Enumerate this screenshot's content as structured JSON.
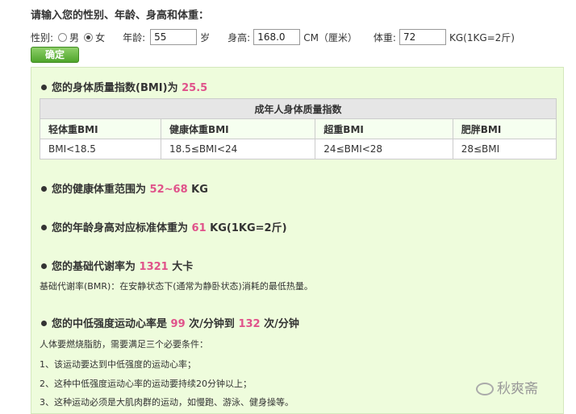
{
  "form": {
    "title": "请输入您的性别、年龄、身高和体重：",
    "gender_label": "性别:",
    "male_label": "男",
    "female_label": "女",
    "age_label": "年龄:",
    "age_value": "55",
    "age_unit": "岁",
    "height_label": "身高:",
    "height_value": "168.0",
    "height_unit": "CM（厘米）",
    "weight_label": "体重:",
    "weight_value": "72",
    "weight_unit": "KG(1KG=2斤)",
    "submit_label": "确定",
    "selected_gender": "女"
  },
  "results": {
    "bmi": {
      "prefix": "您的身体质量指数(BMI)为",
      "value": "25.5"
    },
    "table": {
      "caption": "成年人身体质量指数",
      "headers": [
        "轻体重BMI",
        "健康体重BMI",
        "超重BMI",
        "肥胖BMI"
      ],
      "values": [
        "BMI<18.5",
        "18.5≤BMI<24",
        "24≤BMI<28",
        "28≤BMI"
      ]
    },
    "healthy": {
      "prefix": "您的健康体重范围为",
      "value": "52~68",
      "suffix": "KG"
    },
    "standard": {
      "prefix": "您的年龄身高对应标准体重为",
      "value": "61",
      "suffix": "KG(1KG=2斤)"
    },
    "bmr": {
      "prefix": "您的基础代谢率为",
      "value": "1321",
      "suffix": "大卡",
      "note": "基础代谢率(BMR)：在安静状态下(通常为静卧状态)消耗的最低热量。"
    },
    "heart": {
      "prefix": "您的中低强度运动心率是",
      "value1": "99",
      "mid": "次/分钟到",
      "value2": "132",
      "suffix": "次/分钟",
      "intro": "人体要燃烧脂肪，需要满足三个必要条件：",
      "items": [
        "1、该运动要达到中低强度的运动心率；",
        "2、这种中低强度运动心率的运动要持续20分钟以上；",
        "3、这种运动必须是大肌肉群的运动，如慢跑、游泳、健身操等。"
      ]
    }
  },
  "watermark": "秋爽斋",
  "colors": {
    "highlight": "#e0528a",
    "panel_bg": "#eefcdc",
    "button": "#4fa52c"
  }
}
